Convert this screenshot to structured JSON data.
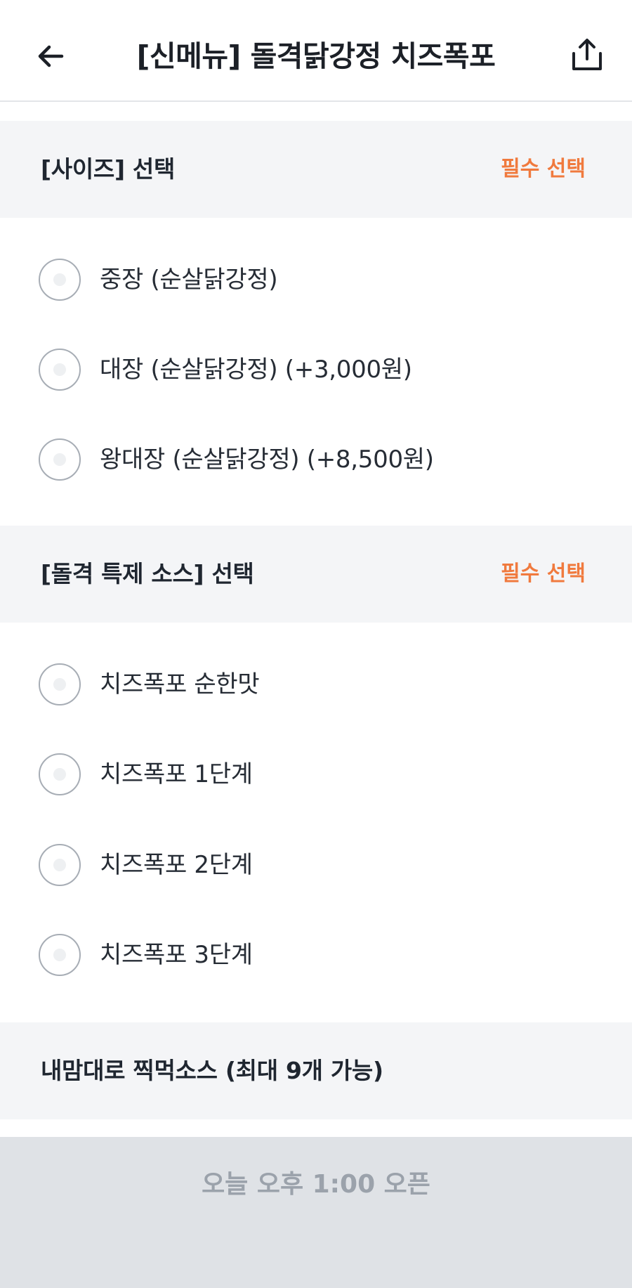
{
  "header": {
    "title": "[신메뉴] 돌격닭강정 치즈폭포",
    "back_icon": "arrow-left-icon",
    "share_icon": "share-icon"
  },
  "sections": [
    {
      "title": "[사이즈] 선택",
      "badge": "필수 선택",
      "options": [
        {
          "label": "중장 (순살닭강정)"
        },
        {
          "label": "대장 (순살닭강정) (+3,000원)"
        },
        {
          "label": "왕대장 (순살닭강정) (+8,500원)"
        }
      ]
    },
    {
      "title": "[돌격 특제 소스] 선택",
      "badge": "필수 선택",
      "options": [
        {
          "label": "치즈폭포 순한맛"
        },
        {
          "label": "치즈폭포 1단계"
        },
        {
          "label": "치즈폭포 2단계"
        },
        {
          "label": "치즈폭포 3단계"
        }
      ]
    },
    {
      "title": "내맘대로 찍먹소스  (최대 9개 가능)"
    }
  ],
  "footer": {
    "button_label": "오늘 오후 1:00 오픈"
  },
  "colors": {
    "accent": "#f07a3e",
    "section_bg": "#f4f5f7",
    "footer_bg": "#dfe2e6",
    "footer_text": "#9ba2ab"
  }
}
